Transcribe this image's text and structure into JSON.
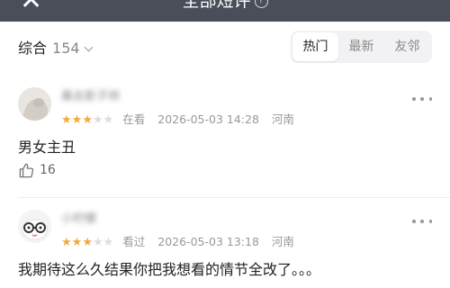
{
  "header": {
    "title": "全部短评",
    "help_icon": "?"
  },
  "filter": {
    "sort_label": "综合",
    "count": "154",
    "tabs": [
      {
        "label": "热门",
        "active": true
      },
      {
        "label": "最新",
        "active": false
      },
      {
        "label": "友邻",
        "active": false
      }
    ]
  },
  "comments": [
    {
      "username": "桑去影子帅",
      "rating": 3,
      "status": "在看",
      "datetime": "2026-05-03 14:28",
      "location": "河南",
      "text": "男女主丑",
      "likes": "16"
    },
    {
      "username": "小柠檬",
      "rating": 3,
      "status": "看过",
      "datetime": "2026-05-03 13:18",
      "location": "河南",
      "text": "我期待这么久结果你把我想看的情节全改了。。。",
      "likes": ""
    }
  ],
  "colors": {
    "star_on": "#f4a93a",
    "star_off": "#dddddd",
    "header_bg": "#4a4e58"
  }
}
